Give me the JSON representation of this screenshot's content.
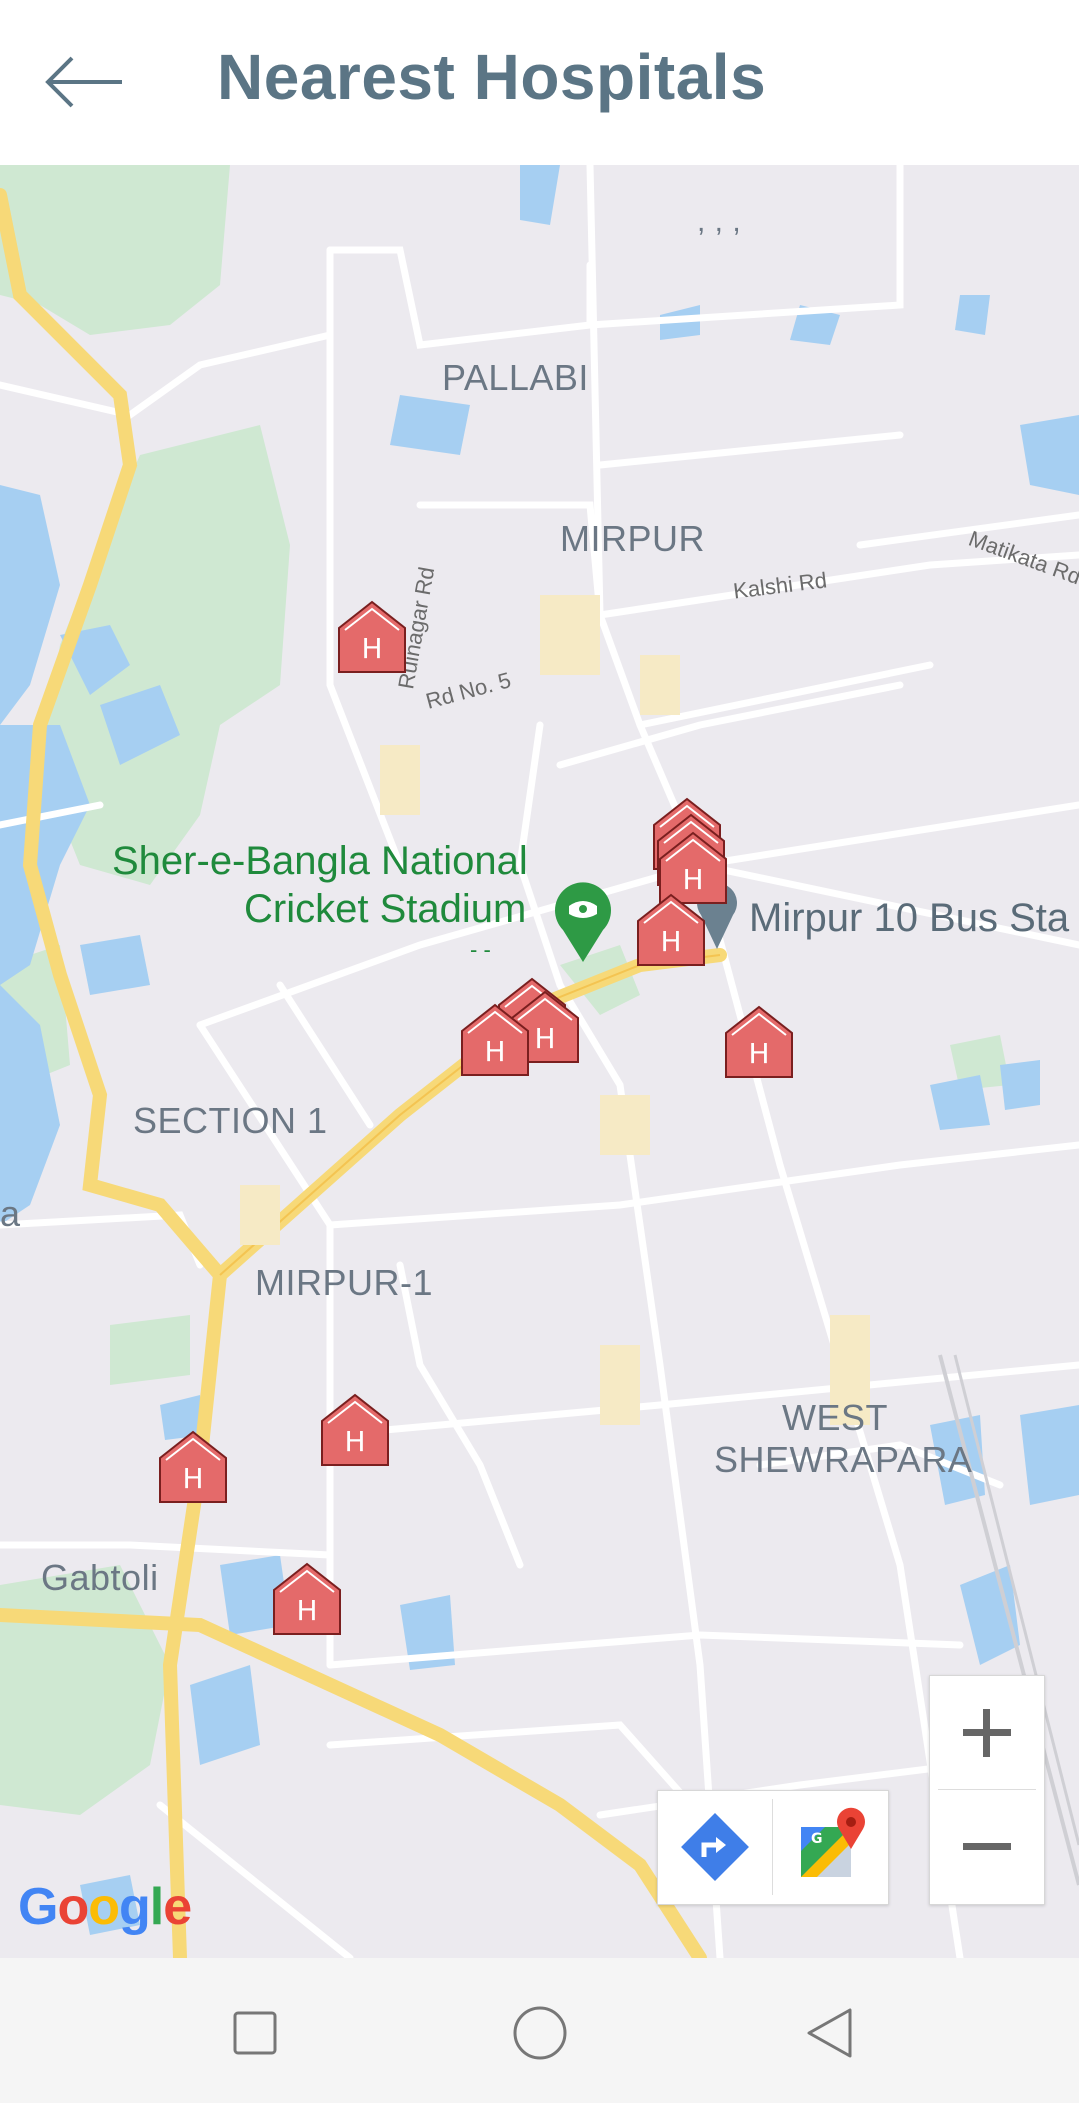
{
  "header": {
    "title": "Nearest Hospitals",
    "back_icon": "arrow-left-icon"
  },
  "map": {
    "area_labels": {
      "pallabi": "PALLABI",
      "mirpur": "MIRPUR",
      "section1": "SECTION 1",
      "mirpur1": "MIRPUR-1",
      "west": "WEST",
      "shewrapara": "SHEWRAPARA",
      "gabtoli": "Gabtoli",
      "edge_a": "a",
      "ticks": ", , ,"
    },
    "road_labels": {
      "kalshi": "Kalshi Rd",
      "matikata": "Matikata Rd",
      "rd5": "Rd No. 5",
      "ruinagar": "Ruinagar Rd"
    },
    "poi": {
      "stadium_line1": "Sher-e-Bangla National",
      "stadium_line2": "Cricket Stadium",
      "stadium_sub": "- -",
      "bus_stand": "Mirpur 10 Bus Sta"
    },
    "marker_letter": "H",
    "marker_color": "#e46a6a",
    "attribution": {
      "g": "G",
      "o1": "o",
      "o2": "o",
      "g2": "g",
      "l": "l",
      "e": "e"
    }
  },
  "controls": {
    "zoom_in": "+",
    "zoom_out": "−",
    "directions_icon": "directions-icon",
    "maps_icon": "google-maps-icon"
  },
  "navbar": {
    "recent": "square-icon",
    "home": "circle-icon",
    "back": "triangle-back-icon"
  }
}
